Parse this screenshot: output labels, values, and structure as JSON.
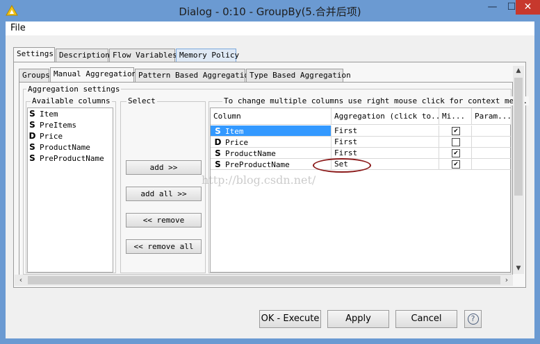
{
  "window": {
    "title": "Dialog - 0:10 - GroupBy(5.合并后项)",
    "min_glyph": "—",
    "max_glyph": "☐",
    "close_glyph": "✕"
  },
  "menu": {
    "file": "File"
  },
  "top_tabs": [
    "Settings",
    "Description",
    "Flow Variables",
    "Memory Policy"
  ],
  "inner_tabs": [
    "Groups",
    "Manual Aggregation",
    "Pattern Based Aggregation",
    "Type Based Aggregation"
  ],
  "aggregation_settings_label": "Aggregation settings",
  "available_columns": {
    "label": "Available columns",
    "items": [
      {
        "type": "S",
        "name": "Item"
      },
      {
        "type": "S",
        "name": "PreItems"
      },
      {
        "type": "D",
        "name": "Price"
      },
      {
        "type": "S",
        "name": "ProductName"
      },
      {
        "type": "S",
        "name": "PreProductName"
      }
    ]
  },
  "select": {
    "label": "Select",
    "add": "add >>",
    "add_all": "add all >>",
    "remove": "<< remove",
    "remove_all": "<< remove all"
  },
  "right_panel": {
    "hint": "To change multiple columns use right mouse click for context menu.",
    "headers": [
      "Column",
      "Aggregation (click to...",
      "Mi...",
      "Param..."
    ],
    "rows": [
      {
        "type": "S",
        "column": "Item",
        "aggregation": "First",
        "missing": true,
        "selected": true
      },
      {
        "type": "D",
        "column": "Price",
        "aggregation": "First",
        "missing": false,
        "selected": false
      },
      {
        "type": "S",
        "column": "ProductName",
        "aggregation": "First",
        "missing": true,
        "selected": false
      },
      {
        "type": "S",
        "column": "PreProductName",
        "aggregation": "Set",
        "missing": true,
        "selected": false
      }
    ]
  },
  "watermark": "http://blog.csdn.net/",
  "bottom_buttons": {
    "ok": "OK - Execute",
    "apply": "Apply",
    "cancel": "Cancel",
    "help": "?"
  },
  "colors": {
    "title_bar": "#6b9ad2",
    "close_button": "#c7382d",
    "selection": "#3399ff",
    "annotation_ellipse": "#8b1a1a"
  }
}
